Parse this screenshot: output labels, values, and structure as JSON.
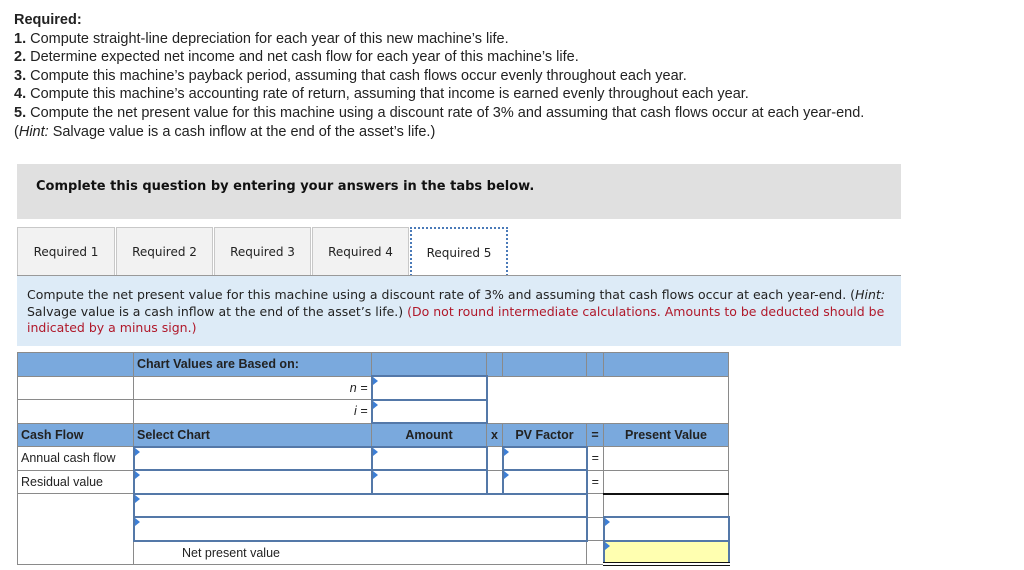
{
  "required": {
    "title": "Required:",
    "items": [
      {
        "num": "1.",
        "text": " Compute straight-line depreciation for each year of this new machine’s life."
      },
      {
        "num": "2.",
        "text": " Determine expected net income and net cash flow for each year of this machine’s life."
      },
      {
        "num": "3.",
        "text": " Compute this machine’s payback period, assuming that cash flows occur evenly throughout each year."
      },
      {
        "num": "4.",
        "text": " Compute this machine’s accounting rate of return, assuming that income is earned evenly throughout each year."
      },
      {
        "num": "5.",
        "text": " Compute the net present value for this machine using a discount rate of 3% and assuming that cash flows occur at each year-end."
      }
    ],
    "hint_open": "(",
    "hint_label": "Hint:",
    "hint_text": " Salvage value is a cash inflow at the end of the asset’s life.)"
  },
  "banner": "Complete this question by entering your answers in the tabs below.",
  "tabs": [
    {
      "label": "Required 1",
      "active": false
    },
    {
      "label": "Required 2",
      "active": false
    },
    {
      "label": "Required 3",
      "active": false
    },
    {
      "label": "Required 4",
      "active": false
    },
    {
      "label": "Required 5",
      "active": true
    }
  ],
  "instructions": {
    "text1": "Compute the net present value for this machine using a discount rate of 3% and assuming that cash flows occur at each year-end. (",
    "hint_label": "Hint:",
    "text2": " Salvage value is a cash inflow at the end of the asset’s life.) ",
    "red_text": "(Do not round intermediate calculations. Amounts to be deducted should be indicated by a minus sign.)"
  },
  "table": {
    "chart_values_label": "Chart Values are Based on:",
    "n_label": "n =",
    "i_label": "i =",
    "n_value": "",
    "i_value": "",
    "headers": {
      "cash_flow": "Cash Flow",
      "select_chart": "Select Chart",
      "amount": "Amount",
      "times": "x",
      "pv_factor": "PV Factor",
      "equals": "=",
      "present_value": "Present Value"
    },
    "rows": [
      {
        "label": "Annual cash flow",
        "select_chart": "",
        "amount": "",
        "pv_factor": "",
        "equals": "=",
        "present_value": ""
      },
      {
        "label": "Residual value",
        "select_chart": "",
        "amount": "",
        "pv_factor": "",
        "equals": "=",
        "present_value": ""
      }
    ],
    "extra_row_1": "",
    "extra_row_2": "",
    "extra_pv": "",
    "npv_label": "Net present value",
    "npv_value": ""
  }
}
